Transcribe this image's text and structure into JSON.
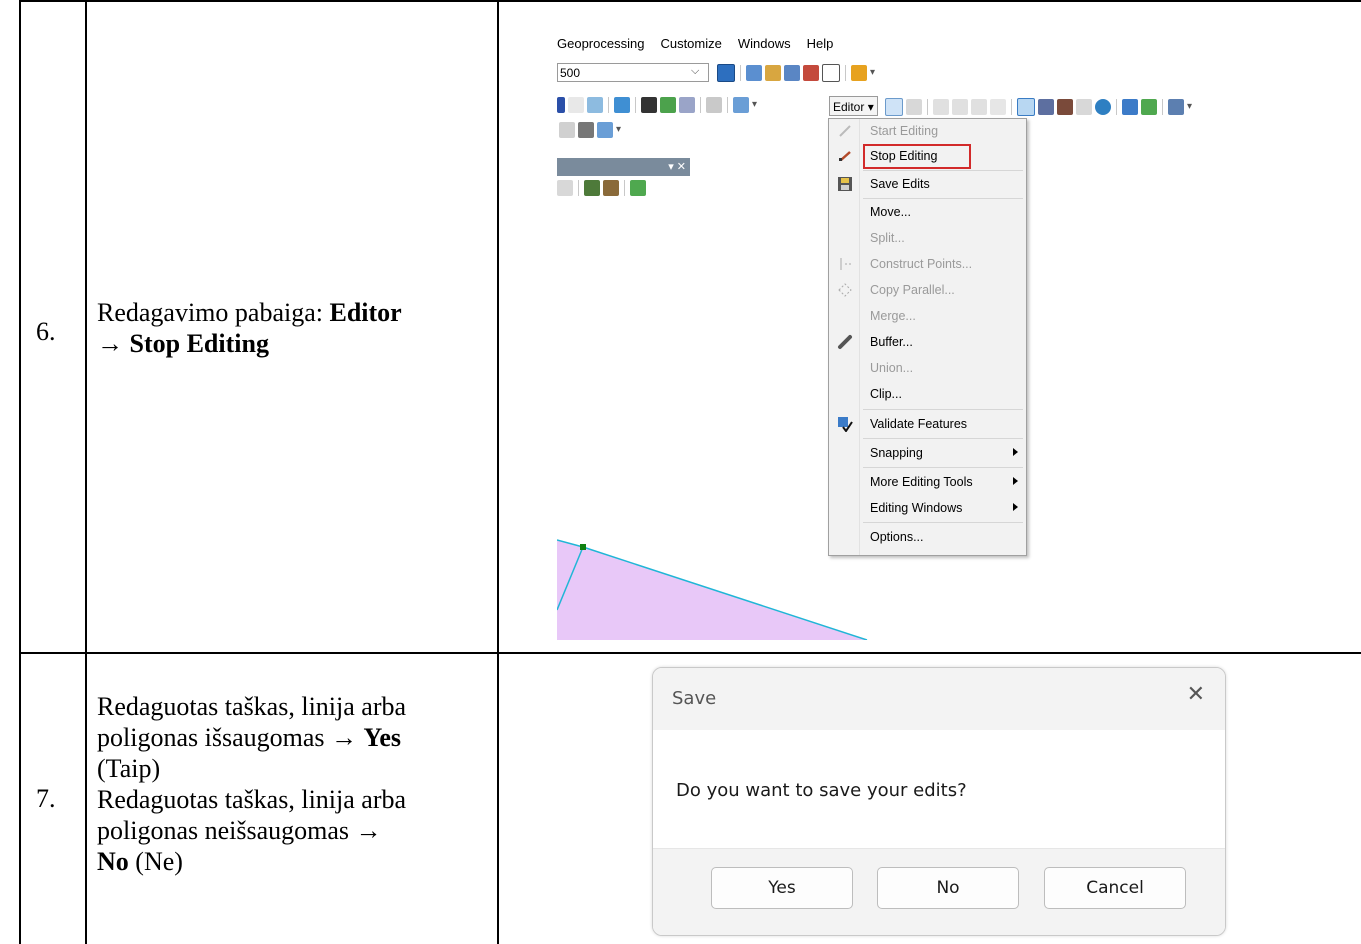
{
  "rows": [
    {
      "number": "6.",
      "text_plain": "Redagavimo pabaiga: ",
      "text_bold_1": "Editor",
      "text_bold_2": "→ Stop Editing"
    },
    {
      "number": "7.",
      "line1": "Redaguotas taškas, linija arba",
      "line2_plain": "poligonas išsaugomas → ",
      "line2_bold": "Yes",
      "line3": "(Taip)",
      "line4": "Redaguotas taškas, linija arba",
      "line5": "poligonas neišsaugomas →",
      "line6_bold": "No",
      "line6_plain": " (Ne)"
    }
  ],
  "arcmap": {
    "menubar": [
      "Geoprocessing",
      "Customize",
      "Windows",
      "Help"
    ],
    "scale_value": "500",
    "editor_button": "Editor",
    "menu_items": [
      {
        "label": "Start Editing",
        "enabled": false,
        "icon": "pencil-icon"
      },
      {
        "label": "Stop Editing",
        "enabled": true,
        "icon": "stop-pencil-icon",
        "highlighted": true
      },
      {
        "label": "Save Edits",
        "enabled": true,
        "icon": "save-edits-icon"
      },
      {
        "label": "Move...",
        "enabled": true,
        "icon": ""
      },
      {
        "label": "Split...",
        "enabled": false,
        "icon": ""
      },
      {
        "label": "Construct Points...",
        "enabled": false,
        "icon": "construct-points-icon"
      },
      {
        "label": "Copy Parallel...",
        "enabled": false,
        "icon": "copy-parallel-icon"
      },
      {
        "label": "Merge...",
        "enabled": false,
        "icon": ""
      },
      {
        "label": "Buffer...",
        "enabled": true,
        "icon": "buffer-icon"
      },
      {
        "label": "Union...",
        "enabled": false,
        "icon": ""
      },
      {
        "label": "Clip...",
        "enabled": true,
        "icon": ""
      },
      {
        "label": "Validate Features",
        "enabled": true,
        "icon": "validate-icon"
      },
      {
        "label": "Snapping",
        "enabled": true,
        "submenu": true
      },
      {
        "label": "More Editing Tools",
        "enabled": true,
        "submenu": true
      },
      {
        "label": "Editing Windows",
        "enabled": true,
        "submenu": true
      },
      {
        "label": "Options...",
        "enabled": true
      }
    ],
    "colors": {
      "highlight": "#d22a2a",
      "polygon_fill": "#e8c8f8",
      "polygon_edge": "#20b6d6",
      "vertex": "#108010"
    }
  },
  "dialog": {
    "title": "Save",
    "close_glyph": "✕",
    "message": "Do you want to save your edits?",
    "buttons": {
      "yes": "Yes",
      "no": "No",
      "cancel": "Cancel"
    }
  }
}
